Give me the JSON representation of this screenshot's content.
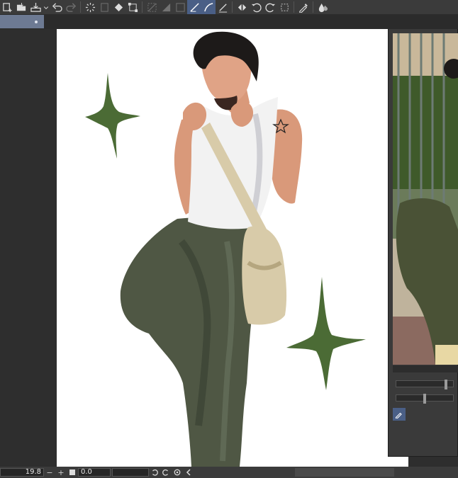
{
  "toolbar": {
    "icons": [
      "new-canvas-icon",
      "open-folder-icon",
      "save-icon",
      "undo-icon",
      "redo-icon",
      "loading-icon",
      "clear-icon",
      "fill-icon",
      "transform-icon",
      "select-all-icon",
      "deselect-icon",
      "invert-selection-icon",
      "snap-ruler-icon",
      "snap-special-ruler-icon",
      "snap-grid-icon",
      "flip-horizontal-icon",
      "rotate-left-icon",
      "rotate-right-icon",
      "crop-icon",
      "eyedropper-icon",
      "water-drop-icon"
    ],
    "active_tools": [
      "snap-ruler-icon",
      "snap-special-ruler-icon"
    ]
  },
  "document_tab": {
    "title": ""
  },
  "artwork": {
    "subject": "",
    "colors": {
      "sparkle": "#4b6b35",
      "pants": "#4f5744",
      "skin": "#d9997a",
      "tank": "#f2f2f2",
      "bag": "#d8cba9",
      "hair": "#1d1a19"
    }
  },
  "sub_view": {
    "colors": {
      "foliage": "#3f5a2a",
      "fence": "#6d7b74",
      "building": "#c9b89a",
      "jacket": "#4a5236"
    }
  },
  "statusbar": {
    "zoom_value": "19.8",
    "rotation_value": "0.0",
    "minus_label": "−",
    "plus_label": "+"
  },
  "colors": {
    "ui_dark": "#2b2b2b",
    "ui_panel": "#3b3b3b",
    "accent": "#4a5f86"
  }
}
